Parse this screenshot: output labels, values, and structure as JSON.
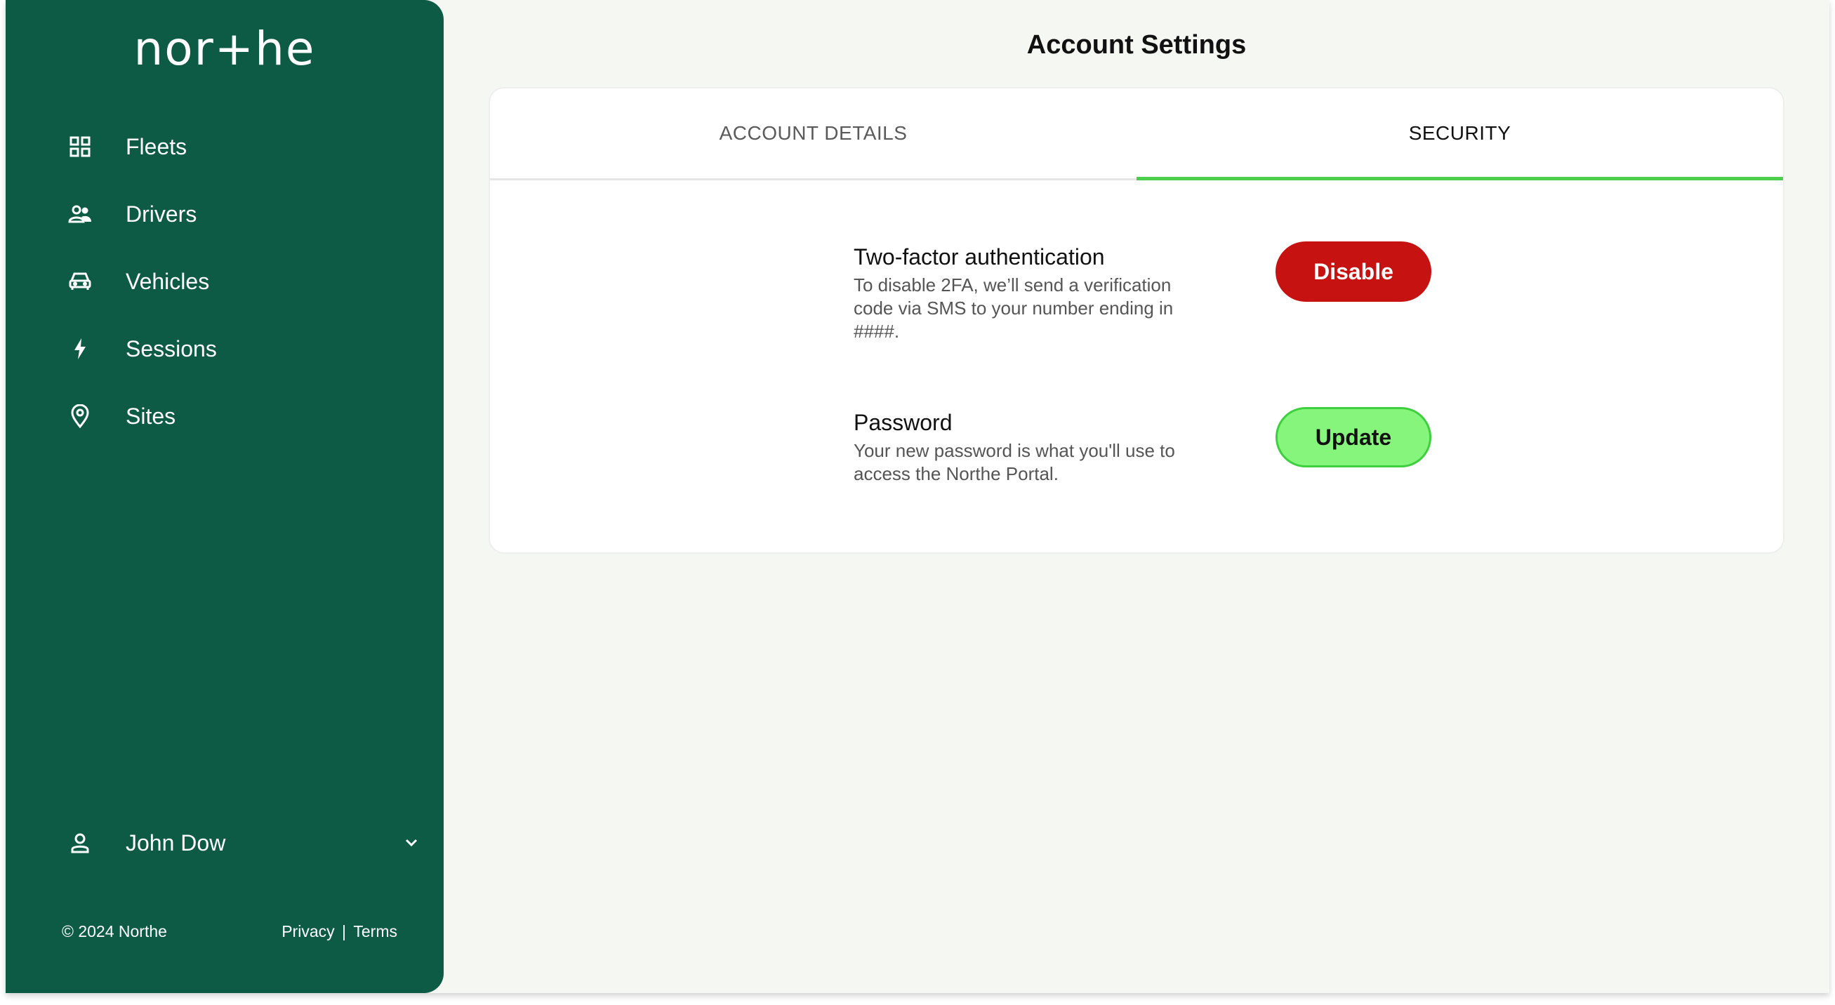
{
  "brand": {
    "logo_text": "nor+he",
    "sidebar_color": "#0d5a45"
  },
  "sidebar": {
    "items": [
      {
        "label": "Fleets",
        "icon": "grid-icon"
      },
      {
        "label": "Drivers",
        "icon": "users-icon"
      },
      {
        "label": "Vehicles",
        "icon": "car-icon"
      },
      {
        "label": "Sessions",
        "icon": "lightning-icon"
      },
      {
        "label": "Sites",
        "icon": "map-pin-icon"
      }
    ],
    "user": {
      "name": "John Dow",
      "icon": "user-icon",
      "menu_icon": "chevron-down-icon"
    },
    "footer": {
      "copyright": "© 2024 Northe",
      "privacy": "Privacy",
      "separator": "|",
      "terms": "Terms"
    }
  },
  "page": {
    "title": "Account Settings"
  },
  "tabs": [
    {
      "label": "ACCOUNT DETAILS",
      "active": false
    },
    {
      "label": "SECURITY",
      "active": true
    }
  ],
  "security": {
    "two_factor": {
      "title": "Two-factor authentication",
      "description": "To disable 2FA, we’ll send a verification code via SMS to your number ending in ####.",
      "button": "Disable",
      "button_color": "#c71212"
    },
    "password": {
      "title": "Password",
      "description": "Your new password is what you'll use to access the Northe Portal.",
      "button": "Update",
      "button_color": "#86f57c"
    }
  }
}
